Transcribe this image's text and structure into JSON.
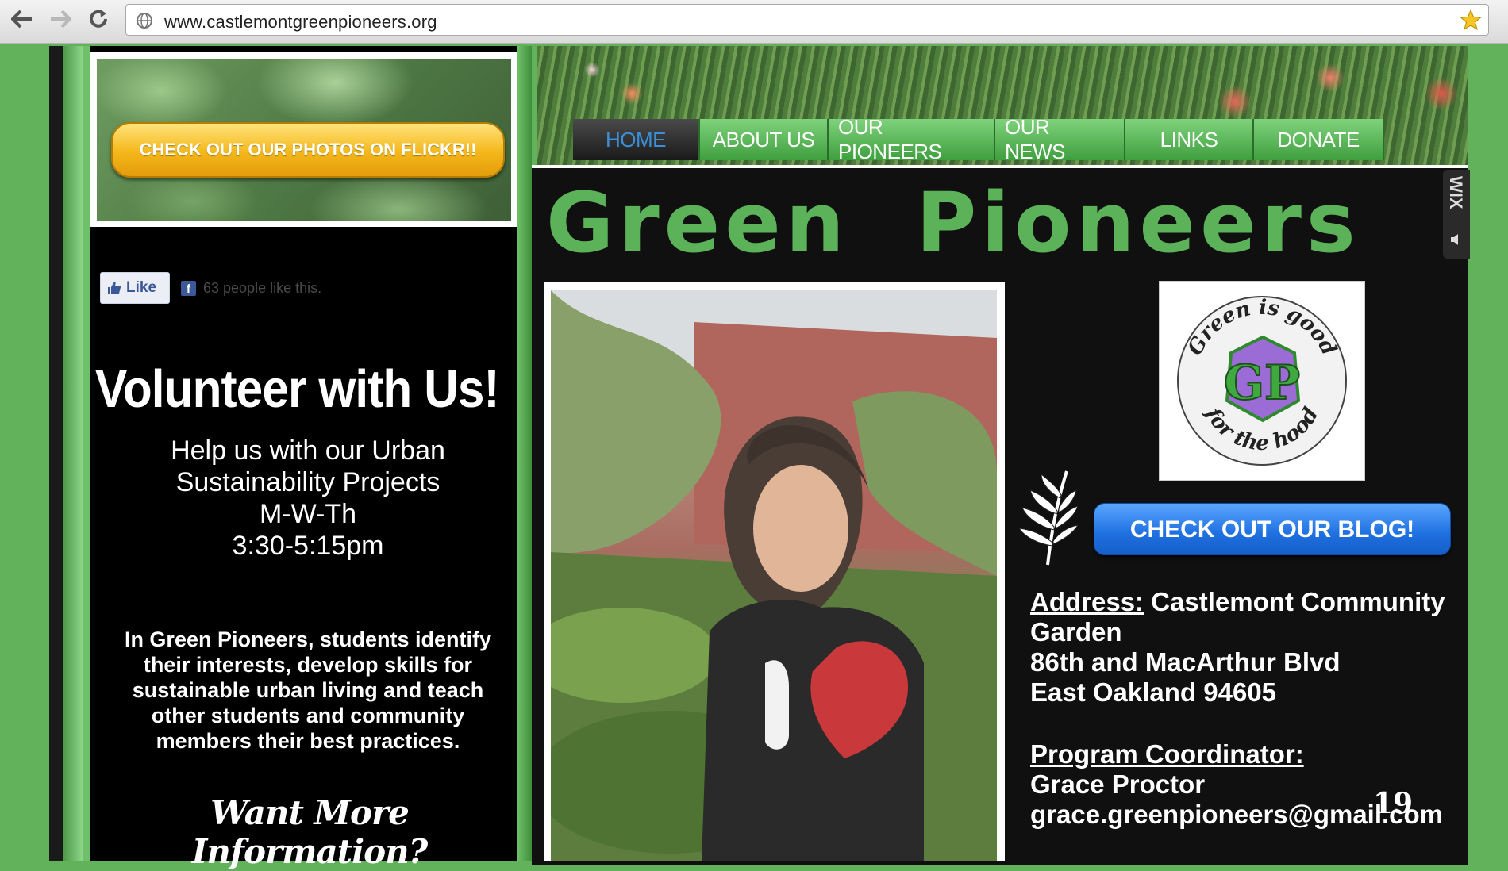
{
  "browser": {
    "url": "www.castlemontgreenpioneers.org"
  },
  "sidebar": {
    "flickr_button": "CHECK OUT OUR PHOTOS ON FLICKR!!",
    "like_button": "Like",
    "like_count": "63 people like this.",
    "volunteer_title": "Volunteer with Us!",
    "help_lines": [
      "Help us with our Urban",
      "Sustainability Projects",
      "M-W-Th",
      "3:30-5:15pm"
    ],
    "blurb": "In Green Pioneers, students identify their interests, develop skills for sustainable urban living and teach other students and community members their best practices.",
    "want_more": "Want More Information?"
  },
  "nav": {
    "items": [
      {
        "label": "HOME",
        "active": true
      },
      {
        "label": "ABOUT US",
        "active": false
      },
      {
        "label": "OUR PIONEERS",
        "active": false
      },
      {
        "label": "OUR NEWS",
        "active": false
      },
      {
        "label": "LINKS",
        "active": false
      },
      {
        "label": "DONATE",
        "active": false
      }
    ]
  },
  "main": {
    "title": "Green  Pioneers",
    "wix_badge": "WIX",
    "logo": {
      "top_text": "Green is good",
      "bottom_text": "for the hood",
      "monogram": "GP"
    },
    "blog_button": "CHECK OUT OUR BLOG!",
    "address_label": "Address:",
    "address_value": "Castlemont Community",
    "address_lines": [
      "Garden",
      "86th and MacArthur Blvd",
      "East Oakland 94605"
    ],
    "coordinator_label": "Program Coordinator:",
    "coordinator_name": "Grace Proctor",
    "coordinator_email": "grace.greenpioneers@gmail.com"
  },
  "slide_number": "19",
  "colors": {
    "page_green": "#62b25c",
    "title_green": "#5cb258",
    "nav_active_text": "#3b8fd8",
    "blog_blue": "#1e6fe0",
    "flickr_yellow": "#f4b71a"
  }
}
